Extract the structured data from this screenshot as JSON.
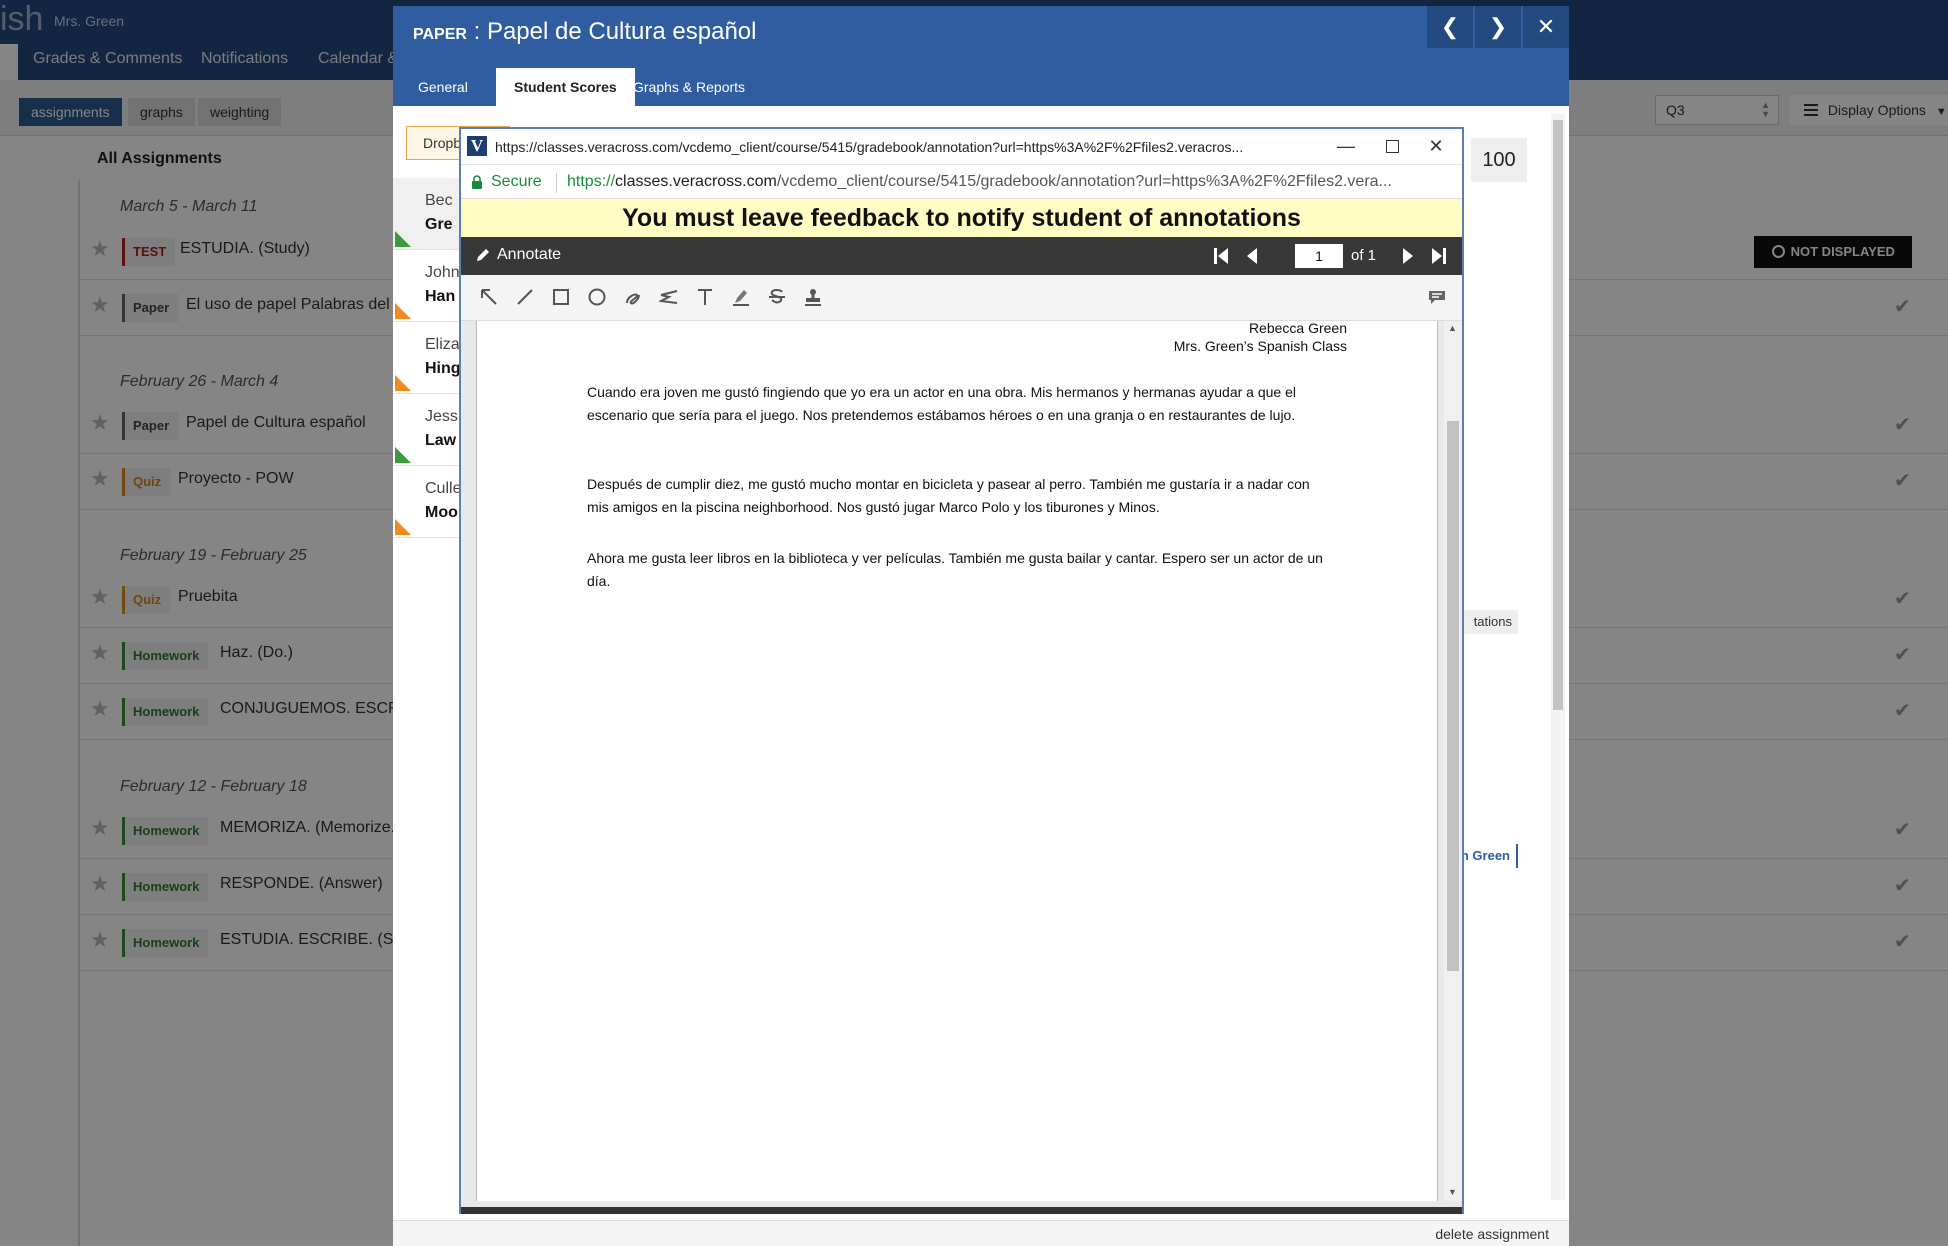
{
  "app": {
    "title": "ish",
    "teacher": "Mrs. Green",
    "nav_tabs": [
      "Grades & Comments",
      "Notifications",
      "Calendar &"
    ],
    "view_chips": [
      "assignments",
      "graphs",
      "weighting"
    ],
    "quarter": "Q3",
    "display_options": "Display Options",
    "list_heading": "All Assignments",
    "not_displayed": "NOT DISPLAYED",
    "weeks": [
      {
        "label": "March 5 - March 11",
        "rows": [
          {
            "type": "TEST",
            "name": "ESTUDIA. (Study)"
          },
          {
            "type": "Paper",
            "name": "El uso de papel Palabras del"
          }
        ]
      },
      {
        "label": "February 26 - March 4",
        "rows": [
          {
            "type": "Paper",
            "name": "Papel de Cultura español"
          },
          {
            "type": "Quiz",
            "name": "Proyecto - POW"
          }
        ]
      },
      {
        "label": "February 19 - February 25",
        "rows": [
          {
            "type": "Quiz",
            "name": "Pruebita"
          },
          {
            "type": "Homework",
            "name": "Haz. (Do.)"
          },
          {
            "type": "Homework",
            "name": "CONJUGUEMOS. ESCRI"
          }
        ]
      },
      {
        "label": "February 12 - February 18",
        "rows": [
          {
            "type": "Homework",
            "name": "MEMORIZA. (Memorize."
          },
          {
            "type": "Homework",
            "name": "RESPONDE. (Answer)"
          },
          {
            "type": "Homework",
            "name": "ESTUDIA. ESCRIBE. (Stu"
          }
        ]
      }
    ]
  },
  "modal": {
    "kind": "PAPER",
    "separator": " : ",
    "title": "Papel de Cultura español",
    "tabs": [
      "General",
      "Student Scores",
      "Graphs & Reports"
    ],
    "active_tab": "Student Scores",
    "drop_label": "Dropb",
    "score": "100",
    "students": [
      {
        "first": "Bec",
        "last": "Gre",
        "flag": "green"
      },
      {
        "first": "John",
        "last": "Han",
        "flag": "orange"
      },
      {
        "first": "Eliza",
        "last": "Hing",
        "flag": "orange"
      },
      {
        "first": "Jess",
        "last": "Law",
        "flag": "green"
      },
      {
        "first": "Culle",
        "last": "Moo",
        "flag": "orange"
      }
    ],
    "side_chip_1": "tations",
    "side_chip_2": "ah Green",
    "delete_label": "delete assignment"
  },
  "popup": {
    "window_url": "https://classes.veracross.com/vcdemo_client/course/5415/gradebook/annotation?url=https%3A%2F%2Ffiles2.veracros...",
    "logo_letter": "V",
    "secure_label": "Secure",
    "address_scheme": "https://",
    "address_domain": "classes.veracross.com",
    "address_path": "/vcdemo_client/course/5415/gradebook/annotation?url=https%3A%2F%2Ffiles2.vera...",
    "feedback_notice": "You must leave feedback to notify student of annotations",
    "annotate_label": "Annotate",
    "page_current": "1",
    "page_total_label": "of 1",
    "tools": [
      "arrow-icon",
      "line-icon",
      "rectangle-icon",
      "ellipse-icon",
      "freehand-icon",
      "polyline-icon",
      "text-icon",
      "highlighter-icon",
      "strikeout-icon",
      "stamp-icon"
    ],
    "document": {
      "author": "Rebecca Green",
      "class_name": "Mrs. Green’s Spanish Class",
      "paragraphs": [
        "Cuando era joven me gustó fingiendo que yo era un actor en una obra. Mis hermanos y hermanas ayudar a que el escenario que sería para el juego. Nos pretendemos estábamos héroes o en una granja o en restaurantes de lujo.",
        "Después de cumplir diez, me gustó mucho montar en bicicleta y pasear al perro. También me gustaría ir a nadar con mis amigos en la piscina neighborhood. Nos gustó jugar Marco Polo y los tiburones y Minos.",
        "Ahora me gusta leer libros en la biblioteca y ver películas. También me gusta bailar y cantar. Espero ser un actor de un día."
      ]
    }
  },
  "colors": {
    "header_blue": "#234a7e",
    "modal_blue": "#2f5da0",
    "notice_yellow": "#fffdc4",
    "secure_green": "#1a8a3a",
    "test_red": "#b21f1f",
    "quiz_orange": "#d4861c",
    "homework_green": "#2f7a2f"
  }
}
